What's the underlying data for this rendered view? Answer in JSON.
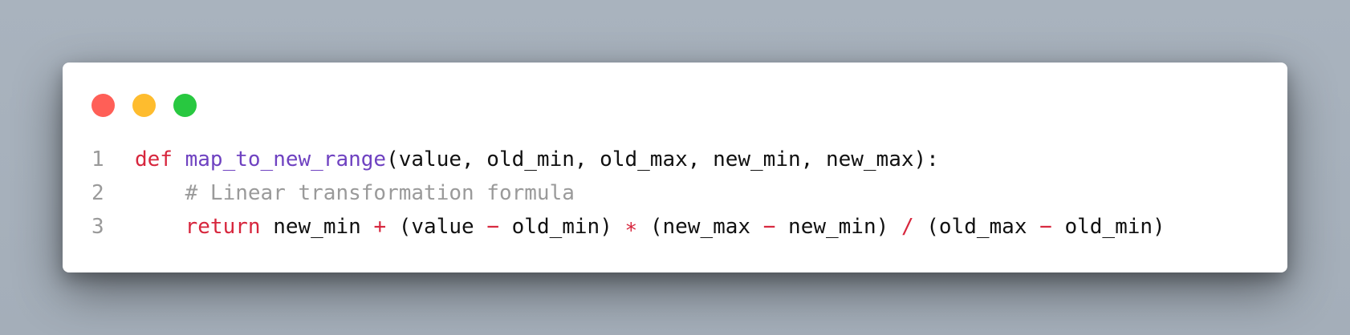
{
  "window": {
    "controls": {
      "close_color": "#ff5f57",
      "minimize_color": "#febc2e",
      "zoom_color": "#28c840"
    }
  },
  "colors": {
    "keyword": "#d7263d",
    "function": "#6f42c1",
    "comment": "#9a9a9a",
    "text": "#111111"
  },
  "code": {
    "lines": [
      {
        "number": "1",
        "tokens": [
          {
            "type": "kw",
            "text": "def"
          },
          {
            "type": "tx",
            "text": " "
          },
          {
            "type": "fn",
            "text": "map_to_new_range"
          },
          {
            "type": "tx",
            "text": "(value, old_min, old_max, new_min, new_max):"
          }
        ]
      },
      {
        "number": "2",
        "tokens": [
          {
            "type": "tx",
            "text": "    "
          },
          {
            "type": "cm",
            "text": "# Linear transformation formula"
          }
        ]
      },
      {
        "number": "3",
        "tokens": [
          {
            "type": "tx",
            "text": "    "
          },
          {
            "type": "kw",
            "text": "return"
          },
          {
            "type": "tx",
            "text": " new_min "
          },
          {
            "type": "op",
            "text": "+"
          },
          {
            "type": "tx",
            "text": " (value "
          },
          {
            "type": "op",
            "text": "−"
          },
          {
            "type": "tx",
            "text": " old_min) "
          },
          {
            "type": "op",
            "text": "∗"
          },
          {
            "type": "tx",
            "text": " (new_max "
          },
          {
            "type": "op",
            "text": "−"
          },
          {
            "type": "tx",
            "text": " new_min) "
          },
          {
            "type": "op",
            "text": "/"
          },
          {
            "type": "tx",
            "text": " (old_max "
          },
          {
            "type": "op",
            "text": "−"
          },
          {
            "type": "tx",
            "text": " old_min)"
          }
        ]
      }
    ]
  }
}
